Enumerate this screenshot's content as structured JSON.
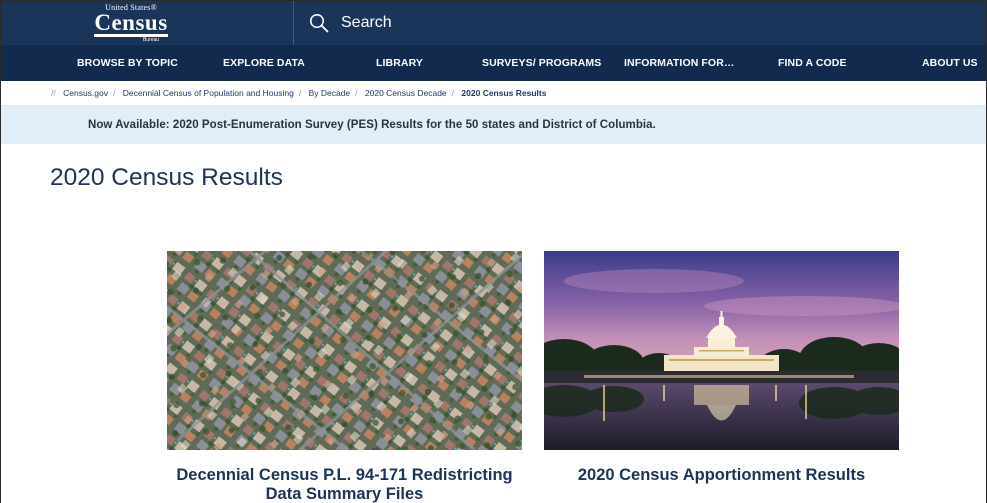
{
  "header": {
    "logo": {
      "top_text": "United States®",
      "main_text": "Census",
      "bottom_text": "Bureau"
    },
    "search": {
      "label": "Search"
    }
  },
  "nav": {
    "items": [
      "BROWSE BY TOPIC",
      "EXPLORE DATA",
      "LIBRARY",
      "SURVEYS/ PROGRAMS",
      "INFORMATION FOR…",
      "FIND A CODE",
      "ABOUT US"
    ]
  },
  "breadcrumb": {
    "root": "//",
    "items": [
      "Census.gov",
      "Decennial Census of Population and Housing",
      "By Decade",
      "2020 Census Decade"
    ],
    "current": "2020 Census Results"
  },
  "banner": {
    "text": "Now Available: 2020 Post-Enumeration Survey (PES) Results for the 50 states and District of Columbia."
  },
  "main": {
    "title": "2020 Census Results",
    "cards": [
      {
        "title_line1": "Decennial Census P.L. 94-171 Redistricting",
        "title_line2": "Data Summary Files"
      },
      {
        "title_line1": "2020 Census Apportionment Results",
        "title_line2": ""
      }
    ]
  },
  "colors": {
    "header_bg": "#1a3559",
    "nav_bg": "#112a4d",
    "banner_bg": "#dfeef9",
    "title_text": "#1b3458"
  }
}
